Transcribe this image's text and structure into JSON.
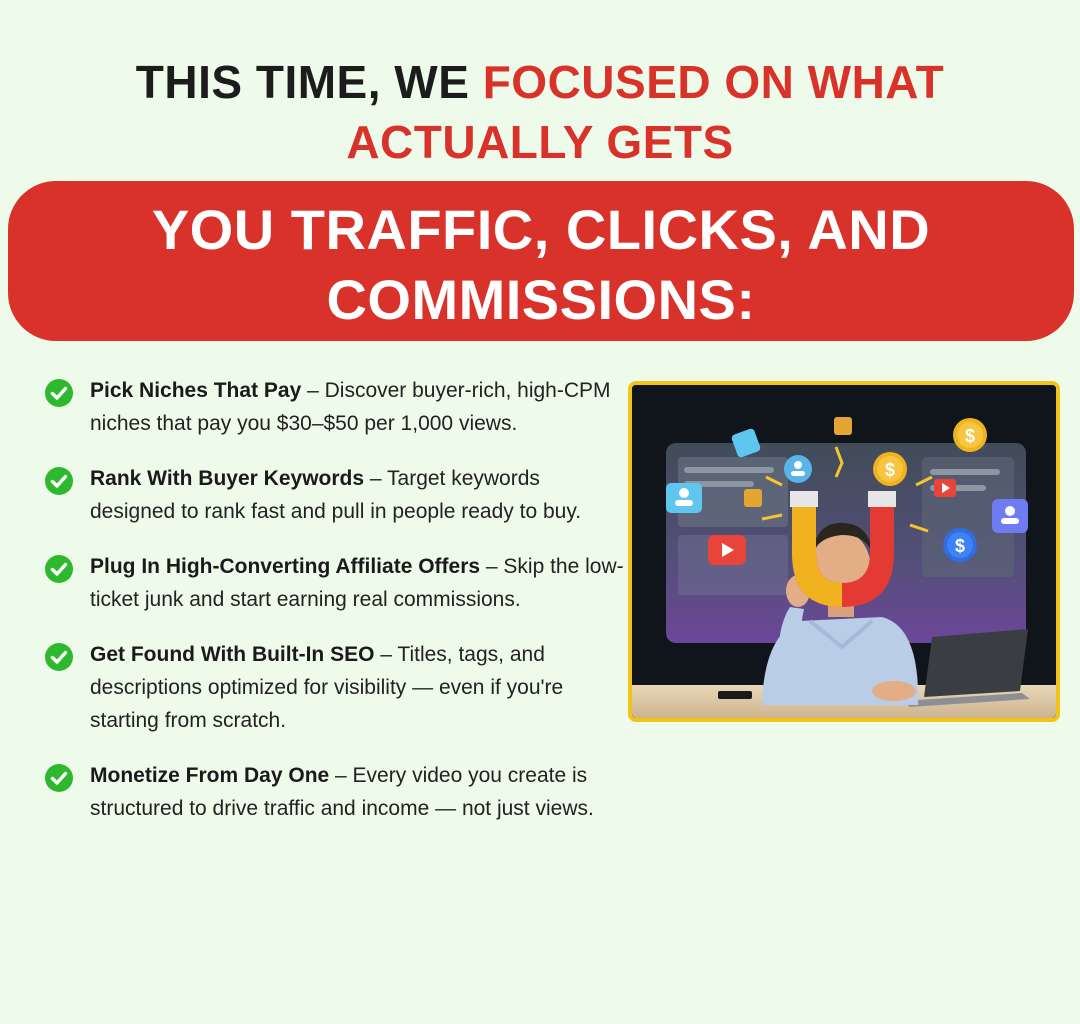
{
  "headline": {
    "line1_dark": "THIS TIME, WE ",
    "line1_red": "FOCUSED ON WHAT",
    "line2_red": "ACTUALLY GETS"
  },
  "banner": {
    "line1": "YOU TRAFFIC, CLICKS, AND",
    "line2": "COMMISSIONS:"
  },
  "features": [
    {
      "title": "Pick Niches That Pay",
      "desc": " – Discover buyer-rich, high-CPM niches that pay you $30–$50 per 1,000 views."
    },
    {
      "title": "Rank With Buyer Keywords",
      "desc": " – Target keywords designed to rank fast and pull in people ready to buy."
    },
    {
      "title": "Plug In High-Converting Affiliate Offers",
      "desc": " – Skip the low-ticket junk and start earning real commissions."
    },
    {
      "title": "Get Found With Built-In SEO",
      "desc": " – Titles, tags, and descriptions optimized for visibility — even if you're starting from scratch."
    },
    {
      "title": "Monetize From Day One",
      "desc": " – Every video you create is structured to drive traffic and income — not just views."
    }
  ],
  "icons": {
    "check": "check-circle-icon",
    "magnet": "magnet-icon",
    "dollar": "dollar-coin-icon",
    "play": "play-button-icon",
    "user": "user-profile-icon"
  },
  "colors": {
    "accent_red": "#d8322a",
    "check_green": "#2eb82e",
    "frame_yellow": "#f2c318",
    "background": "#eefbea"
  },
  "illustration": {
    "dollar_symbol": "$"
  }
}
